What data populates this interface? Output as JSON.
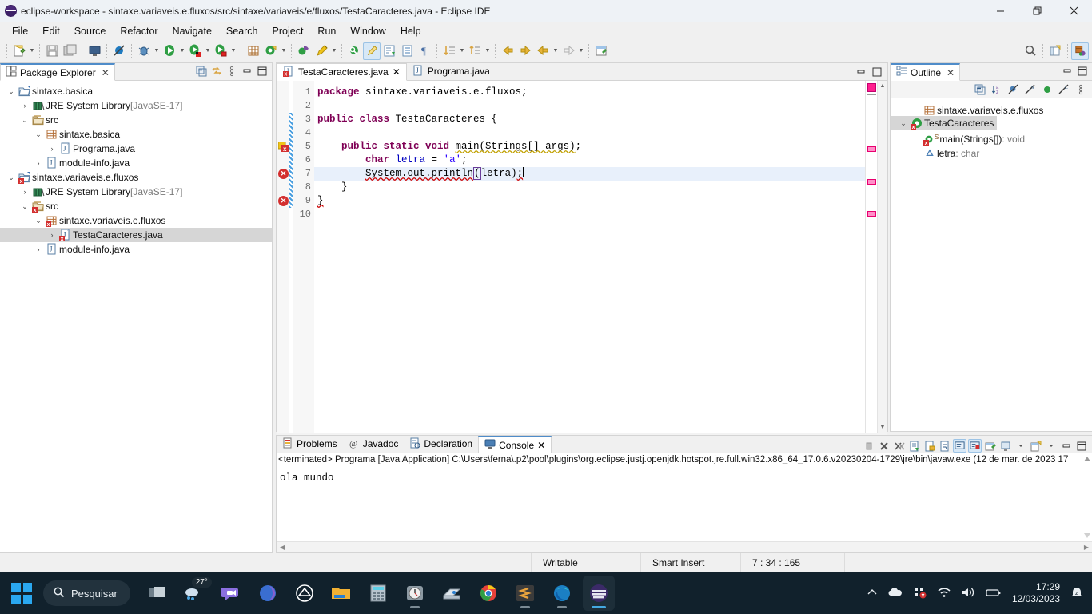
{
  "window": {
    "title": "eclipse-workspace - sintaxe.variaveis.e.fluxos/src/sintaxe/variaveis/e/fluxos/TestaCaracteres.java - Eclipse IDE",
    "minimize": "—",
    "maximize": "❐",
    "close": "✕"
  },
  "menu": [
    "File",
    "Edit",
    "Source",
    "Refactor",
    "Navigate",
    "Search",
    "Project",
    "Run",
    "Window",
    "Help"
  ],
  "package_explorer": {
    "tab_label": "Package Explorer",
    "close": "✕",
    "tools": [
      "collapse-all-icon",
      "link-with-editor-icon",
      "view-menu-icon",
      "minimize-icon",
      "maximize-icon"
    ],
    "tree": [
      {
        "indent": 0,
        "twisty": "⌄",
        "icon": "project-open-icon",
        "label": "sintaxe.basica",
        "dim": "",
        "selected": false,
        "error": false
      },
      {
        "indent": 1,
        "twisty": "›",
        "icon": "library-icon",
        "label": "JRE System Library",
        "dim": "[JavaSE-17]",
        "selected": false,
        "error": false
      },
      {
        "indent": 1,
        "twisty": "⌄",
        "icon": "source-folder-icon",
        "label": "src",
        "dim": "",
        "selected": false,
        "error": false
      },
      {
        "indent": 2,
        "twisty": "⌄",
        "icon": "package-icon",
        "label": "sintaxe.basica",
        "dim": "",
        "selected": false,
        "error": false
      },
      {
        "indent": 3,
        "twisty": "›",
        "icon": "java-file-icon",
        "label": "Programa.java",
        "dim": "",
        "selected": false,
        "error": false
      },
      {
        "indent": 2,
        "twisty": "›",
        "icon": "java-file-icon",
        "label": "module-info.java",
        "dim": "",
        "selected": false,
        "error": false
      },
      {
        "indent": 0,
        "twisty": "⌄",
        "icon": "project-open-icon",
        "label": "sintaxe.variaveis.e.fluxos",
        "dim": "",
        "selected": false,
        "error": true
      },
      {
        "indent": 1,
        "twisty": "›",
        "icon": "library-icon",
        "label": "JRE System Library",
        "dim": "[JavaSE-17]",
        "selected": false,
        "error": false
      },
      {
        "indent": 1,
        "twisty": "⌄",
        "icon": "source-folder-icon",
        "label": "src",
        "dim": "",
        "selected": false,
        "error": true
      },
      {
        "indent": 2,
        "twisty": "⌄",
        "icon": "package-icon",
        "label": "sintaxe.variaveis.e.fluxos",
        "dim": "",
        "selected": false,
        "error": true
      },
      {
        "indent": 3,
        "twisty": "›",
        "icon": "java-file-icon",
        "label": "TestaCaracteres.java",
        "dim": "",
        "selected": true,
        "error": true
      },
      {
        "indent": 2,
        "twisty": "›",
        "icon": "java-file-icon",
        "label": "module-info.java",
        "dim": "",
        "selected": false,
        "error": false
      }
    ]
  },
  "editor": {
    "tabs": [
      {
        "label": "TestaCaracteres.java",
        "active": true,
        "error": true,
        "close": "✕"
      },
      {
        "label": "Programa.java",
        "active": false,
        "error": false,
        "close": ""
      }
    ],
    "minimize": "—",
    "maximize": "❐",
    "line_numbers": [
      "1",
      "2",
      "3",
      "4",
      "5",
      "6",
      "7",
      "8",
      "9",
      "10"
    ],
    "lines": [
      {
        "n": 1,
        "segments": [
          {
            "t": "package ",
            "c": "kw"
          },
          {
            "t": "sintaxe.variaveis.e.fluxos;",
            "c": ""
          }
        ]
      },
      {
        "n": 2,
        "segments": []
      },
      {
        "n": 3,
        "segments": [
          {
            "t": "public class ",
            "c": "kw"
          },
          {
            "t": "TestaCaracteres {",
            "c": ""
          }
        ]
      },
      {
        "n": 4,
        "segments": []
      },
      {
        "n": 5,
        "segments": [
          {
            "t": "    ",
            "c": ""
          },
          {
            "t": "public static void ",
            "c": "kw"
          },
          {
            "t": "main(Strings[] args)",
            "c": "warn"
          },
          {
            "t": ";",
            "c": ""
          }
        ]
      },
      {
        "n": 6,
        "segments": [
          {
            "t": "        ",
            "c": ""
          },
          {
            "t": "char ",
            "c": "kw"
          },
          {
            "t": "letra",
            "c": "fld"
          },
          {
            "t": " = ",
            "c": ""
          },
          {
            "t": "'a'",
            "c": "lit"
          },
          {
            "t": ";",
            "c": ""
          }
        ]
      },
      {
        "n": 7,
        "segments": [
          {
            "t": "        ",
            "c": ""
          },
          {
            "t": "System.out.println",
            "c": "err"
          },
          {
            "t": "(",
            "c": "brace"
          },
          {
            "t": "letra)",
            "c": ""
          },
          {
            "t": ";",
            "c": "err"
          }
        ],
        "highlight": true
      },
      {
        "n": 8,
        "segments": [
          {
            "t": "    }",
            "c": ""
          }
        ]
      },
      {
        "n": 9,
        "segments": [
          {
            "t": "}",
            "c": "err"
          }
        ]
      },
      {
        "n": 10,
        "segments": []
      }
    ],
    "error_lines": [
      7,
      9
    ],
    "warning_lines": [
      5
    ]
  },
  "outline": {
    "tab_label": "Outline",
    "close": "✕",
    "minimize": "—",
    "maximize": "❐",
    "tools": [
      "collapse-all-icon",
      "sort-icon",
      "hide-fields-icon",
      "hide-static-icon",
      "hide-nonpublic-icon",
      "hide-local-icon",
      "view-menu-icon"
    ],
    "items": [
      {
        "indent": 1,
        "twisty": "",
        "icon": "package-icon",
        "label": "sintaxe.variaveis.e.fluxos",
        "suffix": "",
        "selected": false,
        "error": false
      },
      {
        "indent": 0,
        "twisty": "⌄",
        "icon": "class-icon",
        "label": "TestaCaracteres",
        "suffix": "",
        "selected": true,
        "error": true
      },
      {
        "indent": 1,
        "twisty": "",
        "icon": "method-static-icon",
        "label": "main(Strings[])",
        "suffix": " : void",
        "selected": false,
        "error": true
      },
      {
        "indent": 1,
        "twisty": "",
        "icon": "field-icon",
        "label": "letra",
        "suffix": " : char",
        "selected": false,
        "error": false
      }
    ]
  },
  "console": {
    "tabs": [
      {
        "label": "Problems",
        "icon": "problems-icon",
        "active": false,
        "close": ""
      },
      {
        "label": "Javadoc",
        "icon": "javadoc-icon",
        "active": false,
        "close": ""
      },
      {
        "label": "Declaration",
        "icon": "declaration-icon",
        "active": false,
        "close": ""
      },
      {
        "label": "Console",
        "icon": "console-icon",
        "active": true,
        "close": "✕"
      }
    ],
    "minimize": "—",
    "maximize": "❐",
    "header": "<terminated> Programa [Java Application] C:\\Users\\ferna\\.p2\\pool\\plugins\\org.eclipse.justj.openjdk.hotspot.jre.full.win32.x86_64_17.0.6.v20230204-1729\\jre\\bin\\javaw.exe  (12 de mar. de 2023 17",
    "output": "ola mundo"
  },
  "statusbar": {
    "writable": "Writable",
    "insert_mode": "Smart Insert",
    "position": "7 : 34 : 165"
  },
  "taskbar": {
    "search_placeholder": "Pesquisar",
    "weather_temp": "27°",
    "time": "17:29",
    "date": "12/03/2023",
    "apps": [
      {
        "name": "task-view-icon",
        "running": false
      },
      {
        "name": "weather-widget",
        "running": false
      },
      {
        "name": "teams-icon",
        "running": false
      },
      {
        "name": "microsoft-365-icon",
        "running": false
      },
      {
        "name": "browser-icon",
        "running": false
      },
      {
        "name": "file-explorer-icon",
        "running": false
      },
      {
        "name": "calculator-icon",
        "running": false
      },
      {
        "name": "clock-icon",
        "running": true
      },
      {
        "name": "scanner-icon",
        "running": false
      },
      {
        "name": "chrome-icon",
        "running": false
      },
      {
        "name": "sublime-text-icon",
        "running": true
      },
      {
        "name": "edge-icon",
        "running": true
      },
      {
        "name": "eclipse-icon",
        "running": true
      }
    ]
  },
  "colors": {
    "accent": "#4f8cc9",
    "keyword": "#7f0055",
    "literal": "#2a00ff",
    "field": "#0000c0",
    "error": "#d32f2f",
    "marker": "#ff1f8f"
  }
}
